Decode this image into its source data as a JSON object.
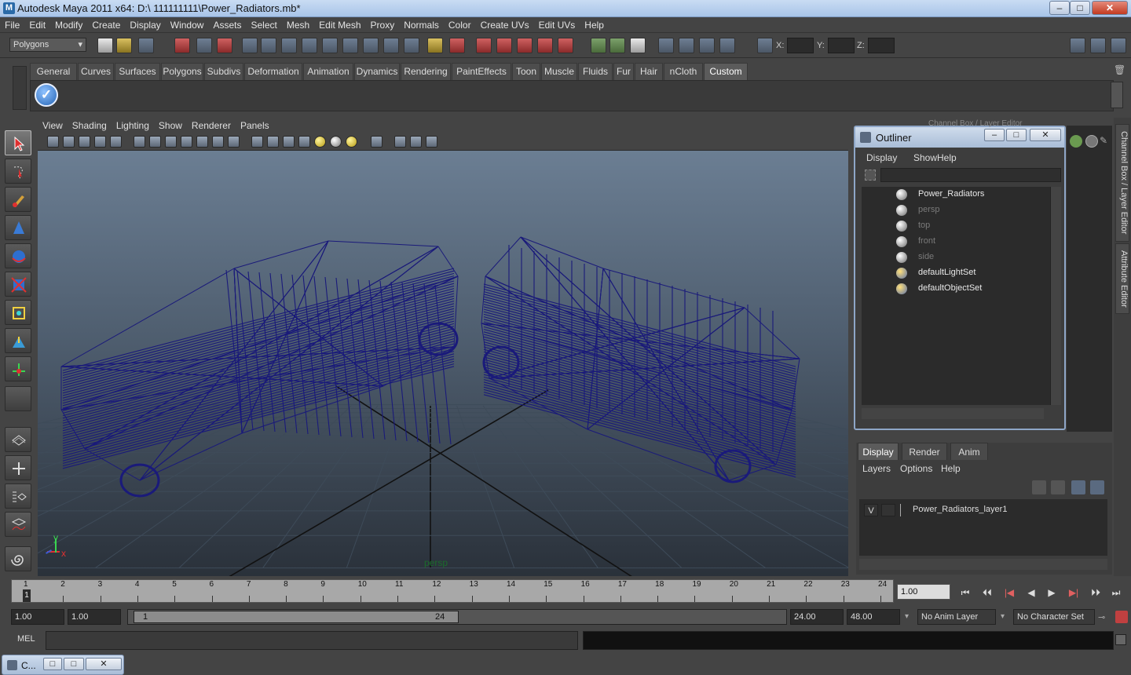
{
  "window": {
    "title": "Autodesk Maya 2011 x64: D:\\ 111111111\\Power_Radiators.mb*",
    "minimize": "–",
    "maximize": "□",
    "close": "✕"
  },
  "menubar": [
    "File",
    "Edit",
    "Modify",
    "Create",
    "Display",
    "Window",
    "Assets",
    "Select",
    "Mesh",
    "Edit Mesh",
    "Proxy",
    "Normals",
    "Color",
    "Create UVs",
    "Edit UVs",
    "Help"
  ],
  "statusline": {
    "mode": "Polygons",
    "x_label": "X:",
    "y_label": "Y:",
    "z_label": "Z:"
  },
  "shelf": {
    "tabs": [
      "General",
      "Curves",
      "Surfaces",
      "Polygons",
      "Subdivs",
      "Deformation",
      "Animation",
      "Dynamics",
      "Rendering",
      "PaintEffects",
      "Toon",
      "Muscle",
      "Fluids",
      "Fur",
      "Hair",
      "nCloth",
      "Custom"
    ],
    "active_tab": "Custom"
  },
  "viewport": {
    "menus": [
      "View",
      "Shading",
      "Lighting",
      "Show",
      "Renderer",
      "Panels"
    ],
    "camera_label": "persp",
    "wire_color": "#1a1a7a",
    "axis_x": "x",
    "axis_y": "y"
  },
  "outliner": {
    "title": "Outliner",
    "menus": [
      "Display",
      "Show",
      "Help"
    ],
    "items": [
      {
        "label": "Power_Radiators",
        "dim": false,
        "icon": "group-icon"
      },
      {
        "label": "persp",
        "dim": true,
        "icon": "camera-icon"
      },
      {
        "label": "top",
        "dim": true,
        "icon": "camera-icon"
      },
      {
        "label": "front",
        "dim": true,
        "icon": "camera-icon"
      },
      {
        "label": "side",
        "dim": true,
        "icon": "camera-icon"
      },
      {
        "label": "defaultLightSet",
        "dim": false,
        "icon": "set-icon"
      },
      {
        "label": "defaultObjectSet",
        "dim": false,
        "icon": "set-icon"
      }
    ]
  },
  "side_tabs": [
    "Channel Box / Layer Editor",
    "Attribute Editor"
  ],
  "channel_box_title": "Channel Box / Layer Editor",
  "layer_editor": {
    "tabs": [
      "Display",
      "Render",
      "Anim"
    ],
    "active_tab": "Display",
    "menus": [
      "Layers",
      "Options",
      "Help"
    ],
    "layers": [
      {
        "visible": "V",
        "name": "Power_Radiators_layer1"
      }
    ]
  },
  "timeline": {
    "ticks": [
      "1",
      "2",
      "3",
      "4",
      "5",
      "6",
      "7",
      "8",
      "9",
      "10",
      "11",
      "12",
      "13",
      "14",
      "15",
      "16",
      "17",
      "18",
      "19",
      "20",
      "21",
      "22",
      "23",
      "24"
    ],
    "current_frame": "1.00",
    "current_marker": "1",
    "playback_icons": [
      "⏮",
      "⏴⏴",
      "|◀",
      "◀",
      "▶",
      "▶|",
      "⏵⏵",
      "⏭"
    ]
  },
  "range": {
    "start_time": "1.00",
    "playback_start": "1.00",
    "range_start_label": "1",
    "range_end_label": "24",
    "playback_end": "24.00",
    "end_time": "48.00",
    "anim_layer": "No Anim Layer",
    "character_set": "No Character Set"
  },
  "command_line": {
    "label": "MEL"
  },
  "minimized_window": {
    "title": "C..."
  }
}
